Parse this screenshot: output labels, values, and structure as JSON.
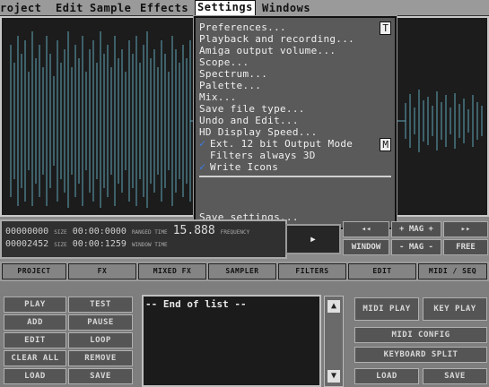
{
  "menubar": {
    "items": [
      "roject",
      "Edit",
      "Sample",
      "Effects",
      "Settings",
      "Windows"
    ]
  },
  "settings_menu": {
    "items": [
      "Preferences...",
      "Playback and recording...",
      "Amiga output volume...",
      "Scope...",
      "Spectrum...",
      "Palette...",
      "Mix...",
      "Save file type...",
      "Undo and Edit...",
      "HD Display Speed...",
      "Ext. 12 bit Output Mode",
      "Filters always 3D",
      "Write Icons",
      "Save settings..."
    ],
    "shortcut_prefs": "T",
    "shortcut_ext": "M"
  },
  "status": {
    "line1_num": "00000000",
    "line1_size": "SIZE",
    "line1_time": "00:00:0000",
    "line1_label": "RANGED TIME",
    "line1_rate": "15.888",
    "line1_rate_label": "FREQUENCY",
    "line2_num": "00002452",
    "line2_size": "SIZE",
    "line2_time": "00:00:1259",
    "line2_label": "WINDOW TIME"
  },
  "transport": {
    "play": "▸",
    "rew": "◂◂",
    "mag_plus": "+ MAG +",
    "ff": "▸▸",
    "window": "WINDOW",
    "mag_minus": "- MAG -",
    "free": "FREE"
  },
  "tabs": [
    "PROJECT",
    "FX",
    "MIXED FX",
    "SAMPLER",
    "FILTERS",
    "EDIT",
    "MIDI / SEQ"
  ],
  "left_buttons": {
    "play": "PLAY",
    "test": "TEST",
    "add": "ADD",
    "pause": "PAUSE",
    "edit": "EDIT",
    "loop": "LOOP",
    "clear_all": "CLEAR ALL",
    "remove": "REMOVE",
    "load": "LOAD",
    "save": "SAVE"
  },
  "list": {
    "header": "-- End of list --"
  },
  "scroll": {
    "up": "▲",
    "down": "▼"
  },
  "right_buttons": {
    "midi_play": "MIDI PLAY",
    "key_play": "KEY PLAY",
    "midi_config": "MIDI CONFIG",
    "keyboard_split": "KEYBOARD SPLIT",
    "load": "LOAD",
    "save": "SAVE"
  }
}
